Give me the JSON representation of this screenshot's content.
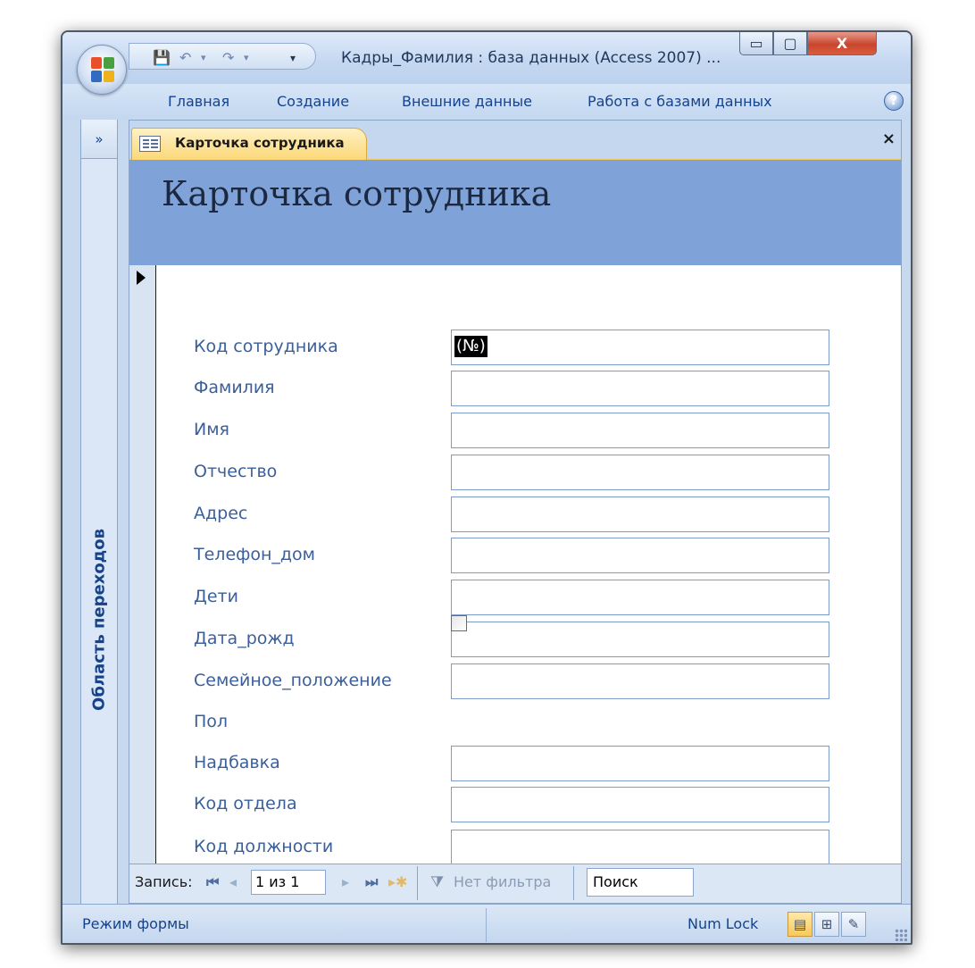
{
  "window": {
    "title": "Кадры_Фамилия : база данных (Access 2007) ...",
    "min_label": "▭",
    "max_label": "▢",
    "close_label": "X"
  },
  "qat": {
    "save_icon": "💾",
    "undo_icon": "↶",
    "redo_icon": "↷",
    "dropdown_icon": "▾"
  },
  "ribbon": {
    "tabs": [
      "Главная",
      "Создание",
      "Внешние данные",
      "Работа с базами данных"
    ],
    "help_label": "?"
  },
  "nav_pane": {
    "expand_label": "»",
    "title": "Область переходов"
  },
  "document": {
    "tab_label": "Карточка сотрудника",
    "close_label": "×",
    "form_title": "Карточка сотрудника"
  },
  "form": {
    "fields": [
      {
        "label": "Код сотрудника",
        "value": "(№)"
      },
      {
        "label": "Фамилия",
        "value": ""
      },
      {
        "label": "Имя",
        "value": ""
      },
      {
        "label": "Отчество",
        "value": ""
      },
      {
        "label": "Адрес",
        "value": ""
      },
      {
        "label": "Телефон_дом",
        "value": ""
      },
      {
        "label": "Дети",
        "value": ""
      },
      {
        "label": "Дата_рожд",
        "value": ""
      },
      {
        "label": "Семейное_положение",
        "value": ""
      },
      {
        "label": "Пол",
        "value": "unchecked"
      },
      {
        "label": "Надбавка",
        "value": ""
      },
      {
        "label": "Код отдела",
        "value": ""
      },
      {
        "label": "Код должности",
        "value": ""
      }
    ]
  },
  "record_nav": {
    "label": "Запись:",
    "first_icon": "⏮",
    "prev_icon": "◂",
    "current": "1 из 1",
    "next_icon": "▸",
    "last_icon": "⏭",
    "new_icon": "▸✱",
    "filter_icon": "⧩",
    "filter_label": "Нет фильтра",
    "search_label": "Поиск"
  },
  "statusbar": {
    "mode": "Режим формы",
    "numlock": "Num Lock",
    "view_form_icon": "▤",
    "view_layout_icon": "⊞",
    "view_design_icon": "✎"
  },
  "colors": {
    "header_band": "#7fa3d9",
    "label_text": "#3b5f9a",
    "active_tab": "#fbd878"
  }
}
